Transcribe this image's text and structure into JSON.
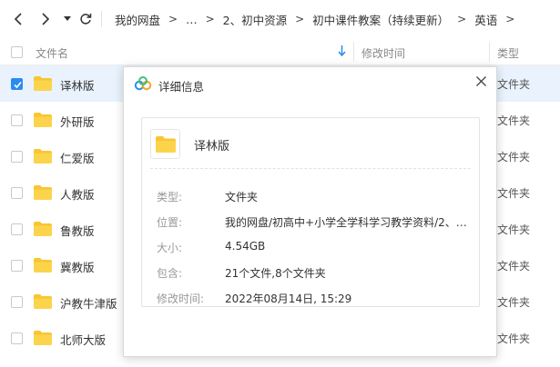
{
  "breadcrumb": [
    "我的网盘",
    "…",
    "2、初中资源",
    "初中课件教案（持续更新）",
    "英语"
  ],
  "breadcrumb_sep": ">",
  "header": {
    "name": "文件名",
    "modified": "修改时间",
    "type": "类型"
  },
  "files": [
    {
      "name": "译林版",
      "type": "文件夹",
      "checked": true
    },
    {
      "name": "外研版",
      "type": "文件夹",
      "checked": false
    },
    {
      "name": "仁爱版",
      "type": "文件夹",
      "checked": false
    },
    {
      "name": "人教版",
      "type": "文件夹",
      "checked": false
    },
    {
      "name": "鲁教版",
      "type": "文件夹",
      "checked": false
    },
    {
      "name": "冀教版",
      "type": "文件夹",
      "checked": false
    },
    {
      "name": "沪教牛津版",
      "type": "文件夹",
      "checked": false
    },
    {
      "name": "北师大版",
      "type": "文件夹",
      "checked": false
    }
  ],
  "dialog": {
    "title": "详细信息",
    "name": "译林版",
    "fields": [
      {
        "label": "类型:",
        "value": "文件夹"
      },
      {
        "label": "位置:",
        "value": "我的网盘/初高中+小学全学科学习教学资料/2、…"
      },
      {
        "label": "大小:",
        "value": "4.54GB"
      },
      {
        "label": "包含:",
        "value": "21个文件,8个文件夹"
      },
      {
        "label": "修改时间:",
        "value": "2022年08月14日, 15:29"
      }
    ]
  },
  "colors": {
    "accent": "#2b8cf0",
    "folder": "#f9c531",
    "selected_row": "#e9f2fd"
  }
}
